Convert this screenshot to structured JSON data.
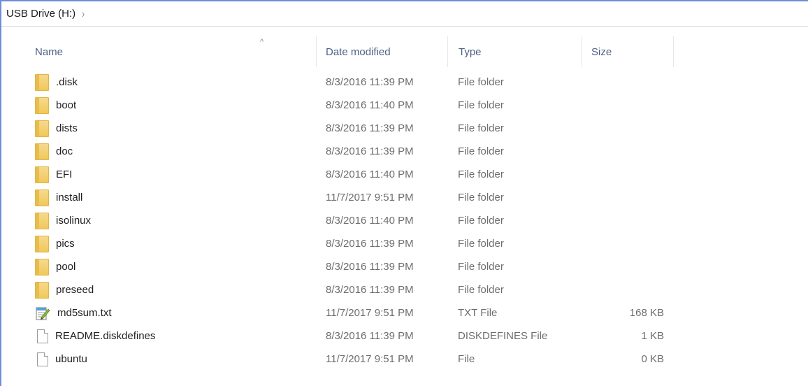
{
  "address": {
    "crumb": "USB Drive (H:)",
    "separator": "›"
  },
  "columns": {
    "name": "Name",
    "date": "Date modified",
    "type": "Type",
    "size": "Size",
    "sort_indicator": "^"
  },
  "files": [
    {
      "name": ".disk",
      "date": "8/3/2016 11:39 PM",
      "type": "File folder",
      "size": "",
      "icon": "folder-icon"
    },
    {
      "name": "boot",
      "date": "8/3/2016 11:40 PM",
      "type": "File folder",
      "size": "",
      "icon": "folder-icon"
    },
    {
      "name": "dists",
      "date": "8/3/2016 11:39 PM",
      "type": "File folder",
      "size": "",
      "icon": "folder-icon"
    },
    {
      "name": "doc",
      "date": "8/3/2016 11:39 PM",
      "type": "File folder",
      "size": "",
      "icon": "folder-icon"
    },
    {
      "name": "EFI",
      "date": "8/3/2016 11:40 PM",
      "type": "File folder",
      "size": "",
      "icon": "folder-icon"
    },
    {
      "name": "install",
      "date": "11/7/2017 9:51 PM",
      "type": "File folder",
      "size": "",
      "icon": "folder-icon"
    },
    {
      "name": "isolinux",
      "date": "8/3/2016 11:40 PM",
      "type": "File folder",
      "size": "",
      "icon": "folder-icon"
    },
    {
      "name": "pics",
      "date": "8/3/2016 11:39 PM",
      "type": "File folder",
      "size": "",
      "icon": "folder-icon"
    },
    {
      "name": "pool",
      "date": "8/3/2016 11:39 PM",
      "type": "File folder",
      "size": "",
      "icon": "folder-icon"
    },
    {
      "name": "preseed",
      "date": "8/3/2016 11:39 PM",
      "type": "File folder",
      "size": "",
      "icon": "folder-icon"
    },
    {
      "name": "md5sum.txt",
      "date": "11/7/2017 9:51 PM",
      "type": "TXT File",
      "size": "168 KB",
      "icon": "text-file-icon"
    },
    {
      "name": "README.diskdefines",
      "date": "8/3/2016 11:39 PM",
      "type": "DISKDEFINES File",
      "size": "1 KB",
      "icon": "file-icon"
    },
    {
      "name": "ubuntu",
      "date": "11/7/2017 9:51 PM",
      "type": "File",
      "size": "0 KB",
      "icon": "file-icon"
    }
  ]
}
